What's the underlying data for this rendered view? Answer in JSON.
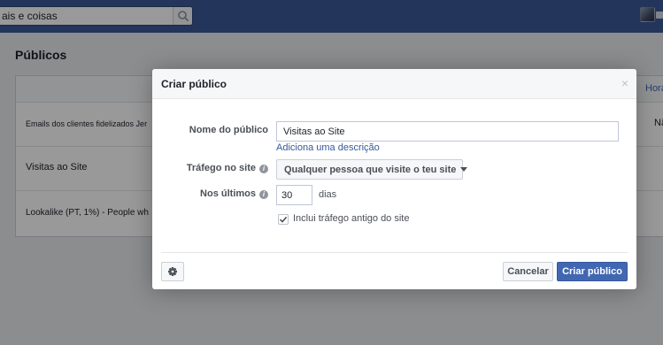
{
  "header": {
    "search_value": "ais e coisas",
    "search_icon": "search-icon"
  },
  "page": {
    "title": "Públicos",
    "column_hora": "Hora",
    "rows": [
      {
        "name": "Emails dos clientes fidelizados Jer",
        "extra": "Nã"
      },
      {
        "name": "Visitas ao Site",
        "extra": ""
      },
      {
        "name": "Lookalike (PT, 1%) - People wh",
        "extra": ""
      }
    ]
  },
  "dialog": {
    "title": "Criar público",
    "close_label": "×",
    "name_label": "Nome do público",
    "name_value": "Visitas ao Site",
    "description_link": "Adiciona uma descrição",
    "traffic_label": "Tráfego no site",
    "traffic_value": "Qualquer pessoa que visite o teu site",
    "last_label": "Nos últimos",
    "last_value": "30",
    "days_label": "dias",
    "include_past_label": "Inclui tráfego antigo do site",
    "include_past_checked": true,
    "cancel_label": "Cancelar",
    "create_label": "Criar público",
    "info_glyph": "i"
  },
  "colors": {
    "topbar": "#3b5998",
    "primary_button": "#4267b2",
    "link": "#365899"
  }
}
